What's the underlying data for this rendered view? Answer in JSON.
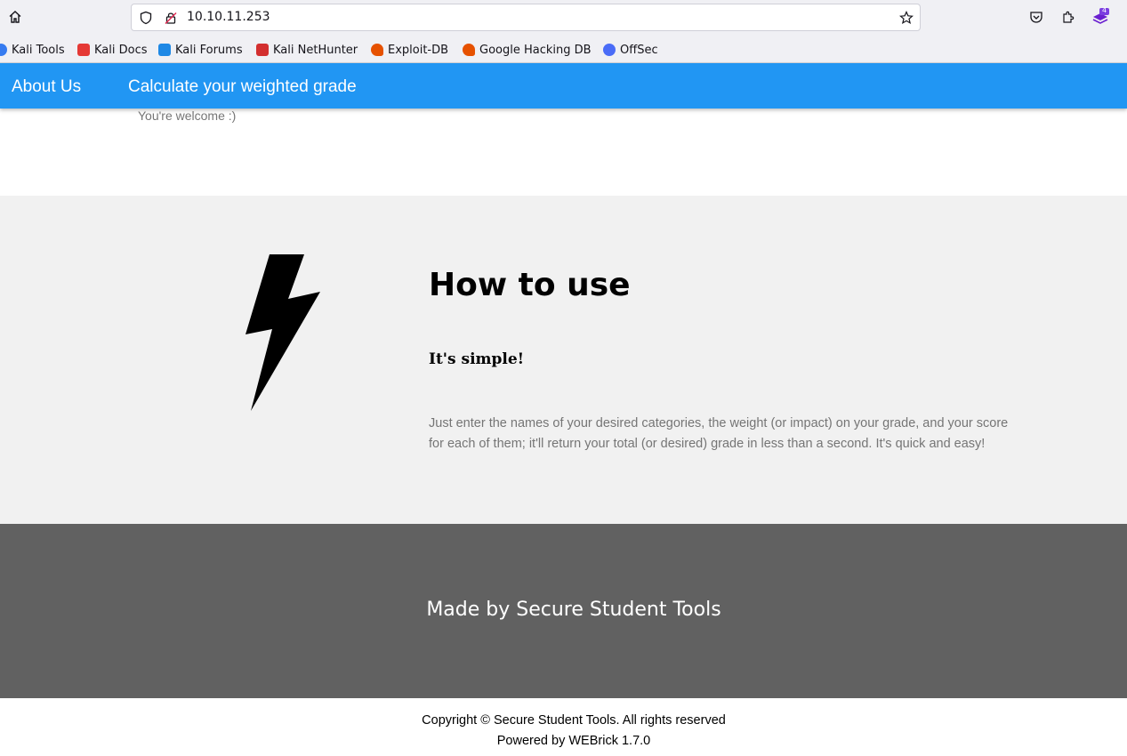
{
  "browser": {
    "url": "10.10.11.253",
    "extension_badge_count": "4",
    "bookmarks": [
      {
        "label": "Kali Tools",
        "icon": "kali-dragon-icon",
        "color": "#367bf0"
      },
      {
        "label": "Kali Docs",
        "icon": "kali-docs-icon",
        "color": "#e53935"
      },
      {
        "label": "Kali Forums",
        "icon": "kali-forums-icon",
        "color": "#1e88e5"
      },
      {
        "label": "Kali NetHunter",
        "icon": "kali-nethunter-icon",
        "color": "#d32f2f"
      },
      {
        "label": "Exploit-DB",
        "icon": "exploit-db-icon",
        "color": "#e65100"
      },
      {
        "label": "Google Hacking DB",
        "icon": "google-hacking-db-icon",
        "color": "#e65100"
      },
      {
        "label": "OffSec",
        "icon": "offsec-icon",
        "color": "#4a6cf7"
      }
    ]
  },
  "nav": {
    "about_label": "About Us",
    "calculate_label": "Calculate your weighted grade",
    "color": "#2196f3"
  },
  "welcome_text": "You're welcome :)",
  "howto": {
    "title": "How to use",
    "subtitle": "It's simple!",
    "description": "Just enter the names of your desired categories, the weight (or impact) on your grade, and your score for each of them; it'll return your total (or desired) grade in less than a second. It's quick and easy!",
    "icon": "lightning-bolt-icon"
  },
  "madeby": {
    "text": "Made by Secure Student Tools",
    "color": "#616161"
  },
  "footer": {
    "copyright": "Copyright © Secure Student Tools. All rights reserved",
    "powered_prefix": "Powered by ",
    "powered_link": "WEBrick 1.7.0"
  }
}
